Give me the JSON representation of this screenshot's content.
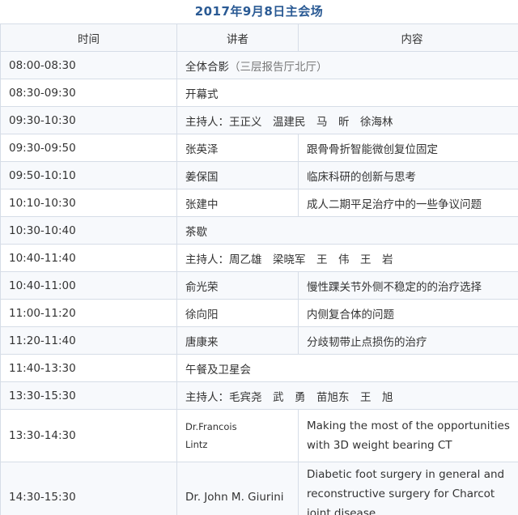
{
  "title": "2017年9月8日主会场",
  "headers": {
    "time": "时间",
    "speaker": "讲者",
    "content": "内容"
  },
  "rows": [
    {
      "time": "08:00-08:30",
      "full": "全体合影",
      "note": "（三层报告厅北厅）"
    },
    {
      "time": "08:30-09:30",
      "full": "开幕式"
    },
    {
      "time": "09:30-10:30",
      "full": "主持人：王正义　温建民　马　昕　徐海林"
    },
    {
      "time": "09:30-09:50",
      "speaker": "张英泽",
      "content": "跟骨骨折智能微创复位固定"
    },
    {
      "time": "09:50-10:10",
      "speaker": "姜保国",
      "content": "临床科研的创新与思考"
    },
    {
      "time": "10:10-10:30",
      "speaker": "张建中",
      "content": "成人二期平足治疗中的一些争议问题"
    },
    {
      "time": "10:30-10:40",
      "full": "茶歇"
    },
    {
      "time": "10:40-11:40",
      "full": "主持人：周乙雄　梁晓军　王　伟　王　岩"
    },
    {
      "time": "10:40-11:00",
      "speaker": "俞光荣",
      "content": "慢性踝关节外侧不稳定的的治疗选择"
    },
    {
      "time": "11:00-11:20",
      "speaker": "徐向阳",
      "content": "内侧复合体的问题"
    },
    {
      "time": "11:20-11:40",
      "speaker": "唐康来",
      "content": "分歧韧带止点损伤的治疗"
    },
    {
      "time": "11:40-13:30",
      "full": "午餐及卫星会"
    },
    {
      "time": "13:30-15:30",
      "full": "主持人：毛宾尧　武　勇　苗旭东　王　旭"
    },
    {
      "time": "13:30-14:30",
      "speaker_lines": [
        "Dr.Francois",
        "Lintz"
      ],
      "content": "Making the most of the opportunities with 3D weight bearing CT"
    },
    {
      "time": "14:30-15:30",
      "speaker": "Dr. John M. Giurini",
      "content": "Diabetic foot surgery in general and reconstructive surgery for Charcot  joint disease"
    }
  ]
}
